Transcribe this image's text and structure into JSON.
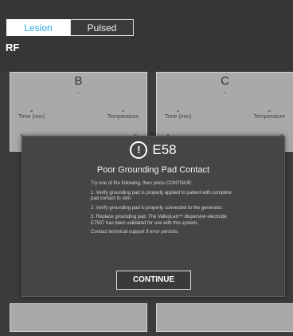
{
  "tabs": {
    "lesion": "Lesion",
    "pulsed": "Pulsed"
  },
  "mode_label": "RF",
  "panels": {
    "b": {
      "label": "B",
      "dash": "-",
      "time_label": "Time (min)",
      "temp_label": "Temperature",
      "time_value": "-",
      "temp_value": "-",
      "lower_left": "-",
      "lower_right": "-"
    },
    "c": {
      "label": "C",
      "dash": "-",
      "time_label": "Time (min)",
      "temp_label": "Temperature",
      "time_value": "-",
      "temp_value": "-",
      "lower_left": "-",
      "lower_right": "-"
    }
  },
  "dialog": {
    "code": "E58",
    "title": "Poor Grounding Pad Contact",
    "intro": "Try one of the following, then press CONTINUE:",
    "step1": "1. Verify grounding pad is properly applied to patient with complete pad contact to skin.",
    "step2": "2. Verify grounding pad is properly connected to the generator.",
    "step3": "3. Replace grounding pad. The ValleyLab™ dispersive electrode E7507 has been validated for use with this system.",
    "support": "Contact technical support if error persists.",
    "continue_label": "CONTINUE"
  },
  "colors": {
    "accent": "#2aa8e0",
    "modal_bg": "#454545",
    "panel_bg": "#a9a9a9"
  }
}
